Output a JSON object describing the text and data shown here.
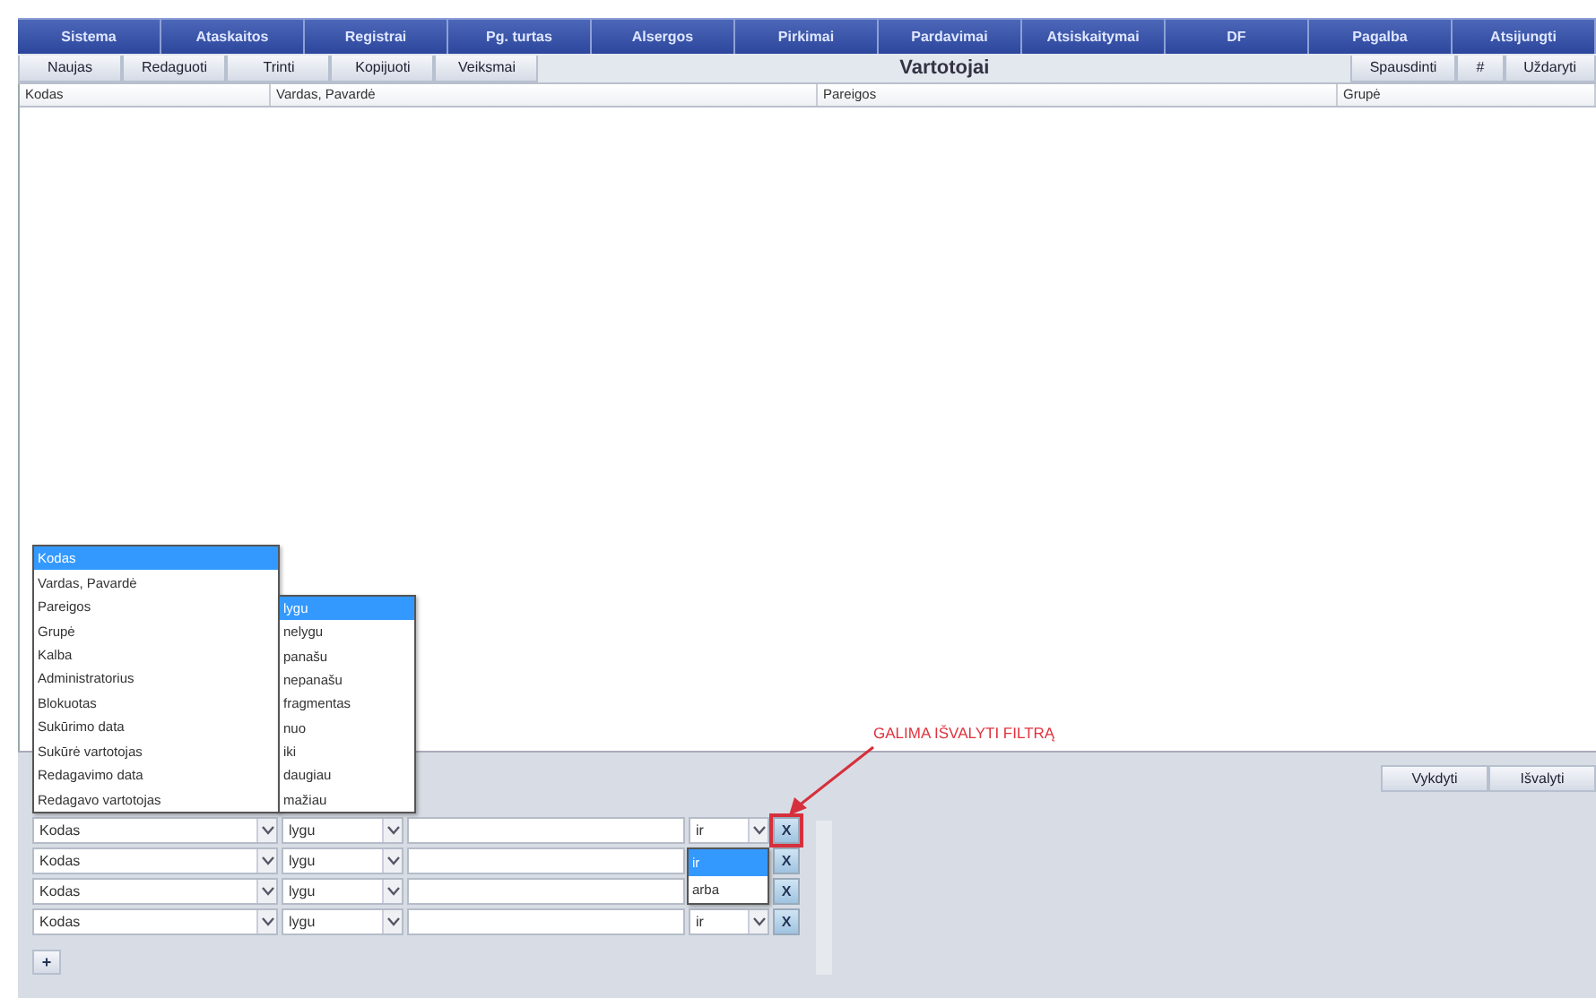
{
  "menu": [
    {
      "label": "Sistema"
    },
    {
      "label": "Ataskaitos"
    },
    {
      "label": "Registrai"
    },
    {
      "label": "Pg. turtas"
    },
    {
      "label": "Alsergos"
    },
    {
      "label": "Pirkimai"
    },
    {
      "label": "Pardavimai"
    },
    {
      "label": "Atsiskaitymai"
    },
    {
      "label": "DF"
    },
    {
      "label": "Pagalba"
    },
    {
      "label": "Atsijungti"
    }
  ],
  "toolbar": {
    "left_buttons": [
      "Naujas",
      "Redaguoti",
      "Trinti",
      "Kopijuoti",
      "Veiksmai"
    ],
    "title": "Vartotojai",
    "right_buttons": [
      "Spausdinti",
      "#",
      "Uždaryti"
    ]
  },
  "table": {
    "columns": [
      "Kodas",
      "Vardas, Pavardė",
      "Pareigos",
      "Grupė"
    ]
  },
  "filter": {
    "buttons": [
      "Vykdyti",
      "Išvalyti"
    ],
    "rows": [
      {
        "field": "Kodas",
        "operator": "lygu",
        "conjunction": "ir",
        "remove_label": "X",
        "highlighted": true
      },
      {
        "field": "Kodas",
        "operator": "lygu",
        "remove_label": "X",
        "highlighted": false
      },
      {
        "field": "Kodas",
        "operator": "lygu",
        "remove_label": "X",
        "highlighted": false
      },
      {
        "field": "Kodas",
        "operator": "lygu",
        "conjunction": "ir",
        "remove_label": "X",
        "highlighted": false
      }
    ],
    "add_label": "+",
    "field_dropdown": [
      {
        "label": "Kodas",
        "selected": true
      },
      {
        "label": "Vardas, Pavardė",
        "selected": false
      },
      {
        "label": "Pareigos",
        "selected": false
      },
      {
        "label": "Grupė",
        "selected": false
      },
      {
        "label": "Kalba",
        "selected": false
      },
      {
        "label": "Administratorius",
        "selected": false
      },
      {
        "label": "Blokuotas",
        "selected": false
      },
      {
        "label": "Sukūrimo data",
        "selected": false
      },
      {
        "label": "Sukūrė vartotojas",
        "selected": false
      },
      {
        "label": "Redagavimo data",
        "selected": false
      },
      {
        "label": "Redagavo vartotojas",
        "selected": false
      }
    ],
    "operator_dropdown": [
      {
        "label": "lygu",
        "selected": true
      },
      {
        "label": "nelygu",
        "selected": false
      },
      {
        "label": "panašu",
        "selected": false
      },
      {
        "label": "nepanašu",
        "selected": false
      },
      {
        "label": "fragmentas",
        "selected": false
      },
      {
        "label": "nuo",
        "selected": false
      },
      {
        "label": "iki",
        "selected": false
      },
      {
        "label": "daugiau",
        "selected": false
      },
      {
        "label": "mažiau",
        "selected": false
      }
    ],
    "conjunction_dropdown": [
      {
        "label": "ir",
        "selected": true
      },
      {
        "label": "arba",
        "selected": false
      }
    ]
  },
  "annotation": {
    "text": "GALIMA IŠVALYTI FILTRĄ"
  }
}
